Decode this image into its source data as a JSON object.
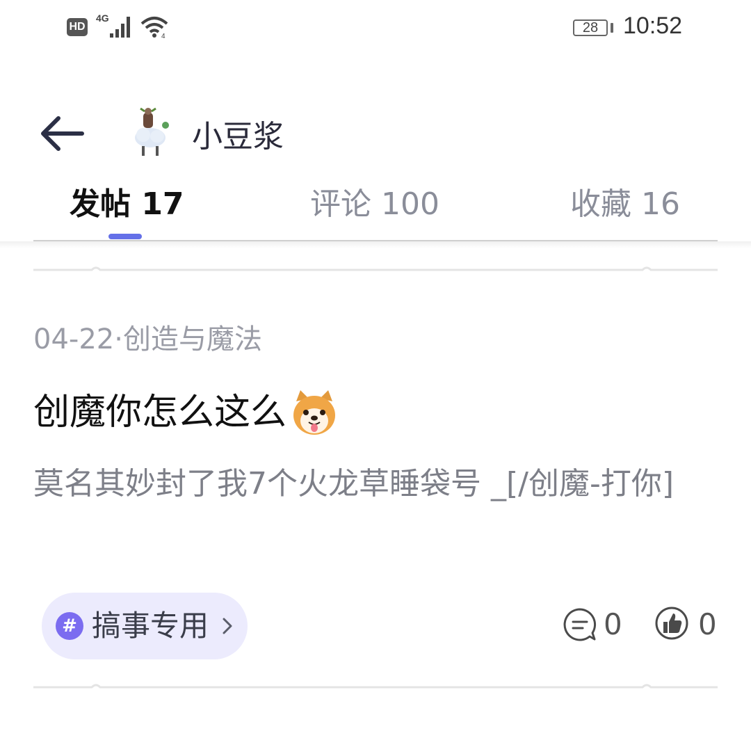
{
  "status_bar": {
    "hd": "HD",
    "network": "4G",
    "battery": "28",
    "time": "10:52"
  },
  "header": {
    "back_icon": "arrow-left-icon",
    "avatar_icon": "sheep-avatar-icon",
    "user_name": "小豆浆"
  },
  "tabs": [
    {
      "label": "发帖 17",
      "active": true
    },
    {
      "label": "评论 100",
      "active": false
    },
    {
      "label": "收藏 16",
      "active": false
    }
  ],
  "accent_color": "#6470e8",
  "post": {
    "meta": "04-22·创造与魔法",
    "title": "创魔你怎么这么",
    "title_emoji": "doge-emoji",
    "body": "莫名其妙封了我7个火龙草睡袋号 _[/创魔-打你]",
    "tag": {
      "hash": "#",
      "label": "搞事专用"
    },
    "comment_count": "0",
    "like_count": "0"
  }
}
